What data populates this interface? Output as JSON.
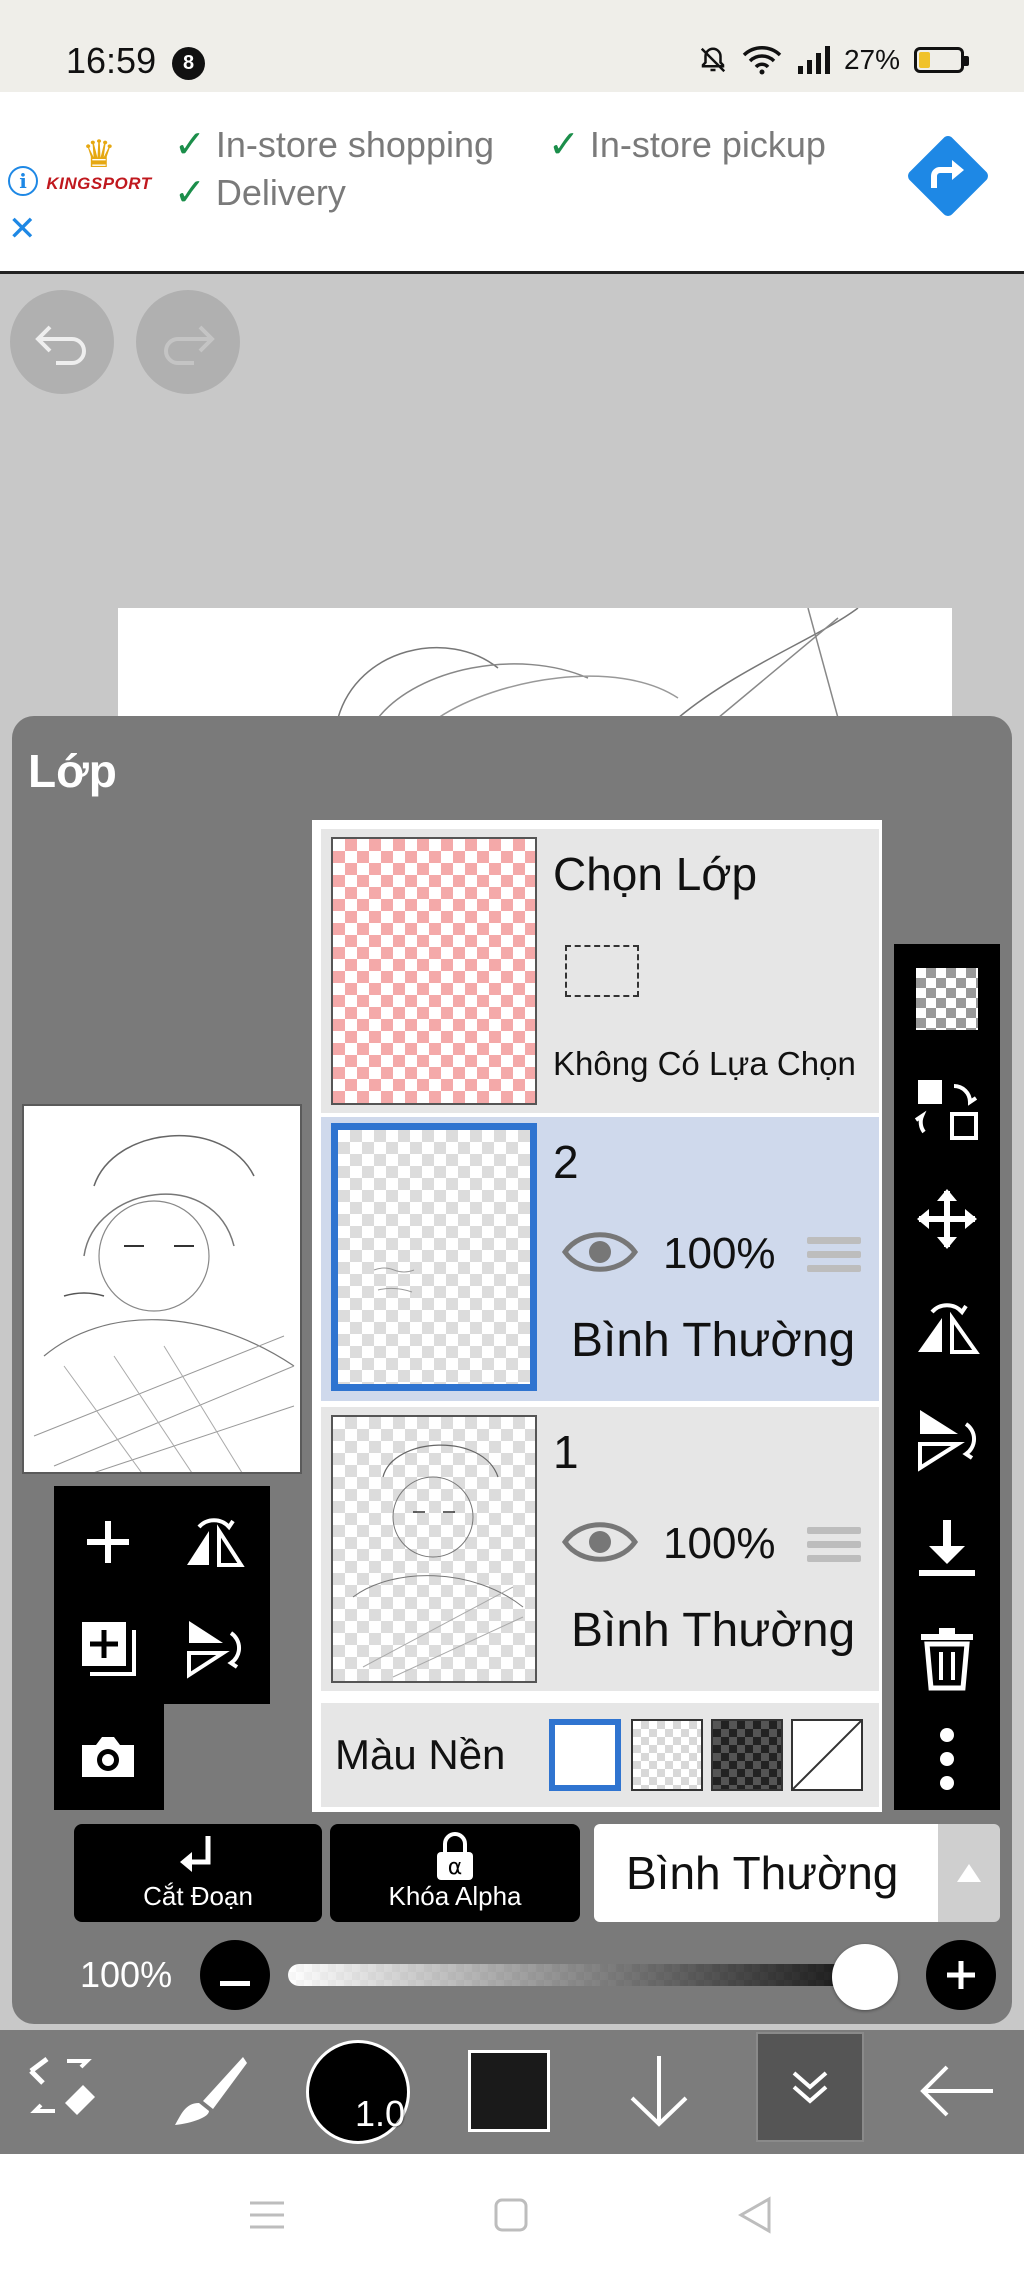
{
  "status_bar": {
    "time": "16:59",
    "notification_count": "8",
    "battery": "27%",
    "battery_level": 0.27
  },
  "ad": {
    "brand": "KINGSPORT",
    "features": [
      "In-store shopping",
      "In-store pickup",
      "Delivery"
    ],
    "accent": "#1e88e5"
  },
  "panel": {
    "title": "Lớp"
  },
  "layers": {
    "selection": {
      "title": "Chọn Lớp",
      "subtitle": "Không Có Lựa Chọn"
    },
    "items": [
      {
        "name": "2",
        "opacity": "100%",
        "blend": "Bình Thường",
        "selected": true
      },
      {
        "name": "1",
        "opacity": "100%",
        "blend": "Bình Thường",
        "selected": false
      }
    ],
    "background": {
      "label": "Màu Nền"
    }
  },
  "controls": {
    "clip_label": "Cắt Đoạn",
    "alpha_lock_label": "Khóa Alpha",
    "blend_mode": "Bình Thường",
    "opacity_label": "100%",
    "opacity_value": 1.0
  },
  "toolbar": {
    "brush_size": "1.0",
    "color": "#1a1a1a"
  },
  "icons": {
    "undo": "undo-icon",
    "redo": "redo-icon",
    "transparency": "checkerboard-icon",
    "swap": "swap-layer-icon",
    "move": "move-icon",
    "flip_h": "flip-horizontal-icon",
    "flip_v": "flip-vertical-icon",
    "merge_down": "merge-down-icon",
    "delete": "trash-icon",
    "more": "more-vertical-icon"
  }
}
